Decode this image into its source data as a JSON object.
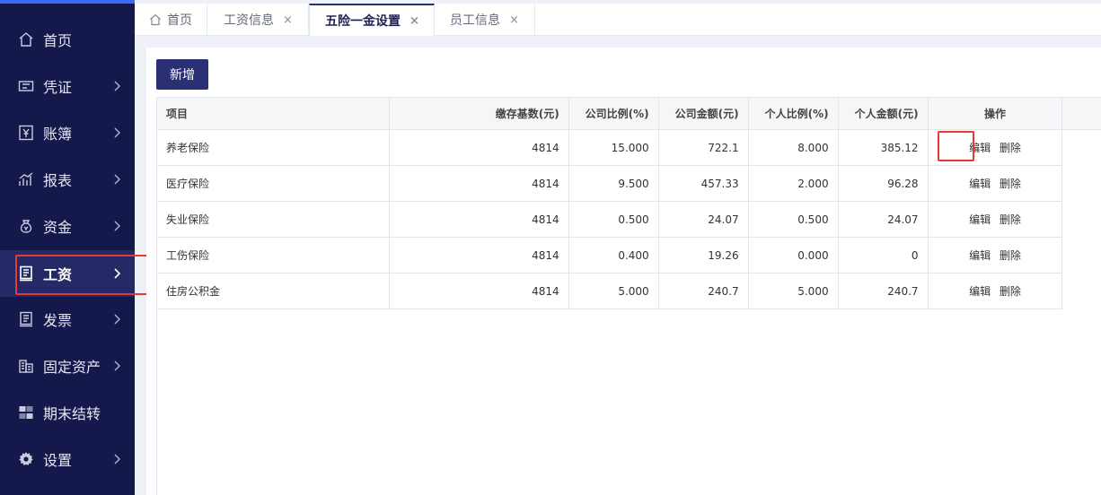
{
  "sidebar": {
    "items": [
      {
        "label": "首页",
        "icon": "home-icon",
        "has_arrow": false
      },
      {
        "label": "凭证",
        "icon": "voucher-icon",
        "has_arrow": true
      },
      {
        "label": "账簿",
        "icon": "yen-book-icon",
        "has_arrow": true
      },
      {
        "label": "报表",
        "icon": "chart-icon",
        "has_arrow": true
      },
      {
        "label": "资金",
        "icon": "money-bag-icon",
        "has_arrow": true
      },
      {
        "label": "工资",
        "icon": "payroll-icon",
        "has_arrow": true,
        "active": true
      },
      {
        "label": "发票",
        "icon": "invoice-icon",
        "has_arrow": true
      },
      {
        "label": "固定资产",
        "icon": "building-icon",
        "has_arrow": true
      },
      {
        "label": "期末结转",
        "icon": "transfer-icon",
        "has_arrow": false
      },
      {
        "label": "设置",
        "icon": "gear-icon",
        "has_arrow": true
      }
    ]
  },
  "tabs": [
    {
      "label": "首页",
      "closable": false
    },
    {
      "label": "工资信息",
      "closable": true
    },
    {
      "label": "五险一金设置",
      "closable": true,
      "active": true
    },
    {
      "label": "员工信息",
      "closable": true
    }
  ],
  "close_glyph": "×",
  "toolbar": {
    "add_label": "新增"
  },
  "table": {
    "headers": [
      "项目",
      "缴存基数(元)",
      "公司比例(%)",
      "公司金额(元)",
      "个人比例(%)",
      "个人金额(元)",
      "操作"
    ],
    "rows": [
      {
        "name": "养老保险",
        "base": "4814",
        "company_rate": "15.000",
        "company_amount": "722.1",
        "personal_rate": "8.000",
        "personal_amount": "385.12"
      },
      {
        "name": "医疗保险",
        "base": "4814",
        "company_rate": "9.500",
        "company_amount": "457.33",
        "personal_rate": "2.000",
        "personal_amount": "96.28"
      },
      {
        "name": "失业保险",
        "base": "4814",
        "company_rate": "0.500",
        "company_amount": "24.07",
        "personal_rate": "0.500",
        "personal_amount": "24.07"
      },
      {
        "name": "工伤保险",
        "base": "4814",
        "company_rate": "0.400",
        "company_amount": "19.26",
        "personal_rate": "0.000",
        "personal_amount": "0"
      },
      {
        "name": "住房公积金",
        "base": "4814",
        "company_rate": "5.000",
        "company_amount": "240.7",
        "personal_rate": "5.000",
        "personal_amount": "240.7"
      }
    ],
    "edit_label": "编辑",
    "delete_label": "删除"
  },
  "colors": {
    "sidebar_bg": "#15184a",
    "sidebar_active": "#252a66",
    "accent": "#2b2f73",
    "highlight": "#e53935"
  }
}
